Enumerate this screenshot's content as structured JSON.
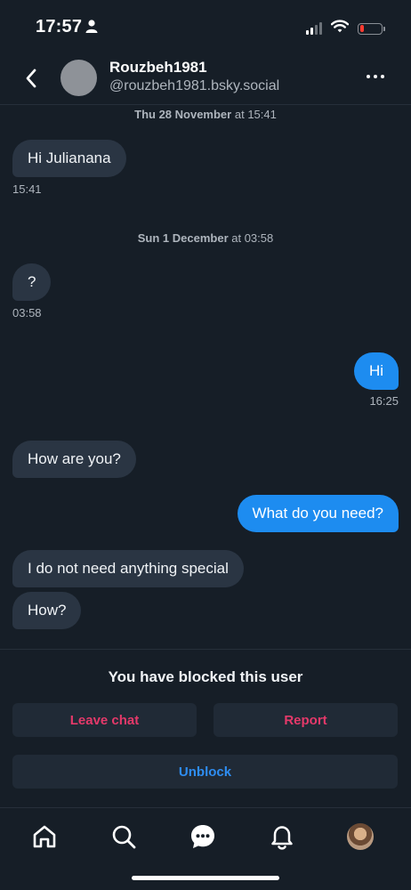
{
  "status_bar": {
    "time": "17:57",
    "battery_level": 0.18,
    "battery_color": "#ff3b30"
  },
  "header": {
    "name": "Rouzbeh1981",
    "handle": "@rouzbeh1981.bsky.social",
    "back_icon": "chevron-left-icon",
    "more_icon": "ellipsis-icon"
  },
  "conversation": {
    "date_1": {
      "day": "Thu 28 November",
      "time": "at 15:41"
    },
    "date_2": {
      "day": "Sun 1 December",
      "time": "at 03:58"
    },
    "messages": [
      {
        "text": "Hi Julianana",
        "direction": "incoming",
        "time": "15:41"
      },
      {
        "text": "?",
        "direction": "incoming",
        "time": "03:58"
      },
      {
        "text": "Hi",
        "direction": "outgoing",
        "time": "16:25"
      },
      {
        "text": "How are you?",
        "direction": "incoming"
      },
      {
        "text": "What do you need?",
        "direction": "outgoing"
      },
      {
        "text": "I do not need anything special",
        "direction": "incoming"
      },
      {
        "text": "How?",
        "direction": "incoming"
      }
    ]
  },
  "blocked": {
    "message": "You have blocked this user",
    "leave_label": "Leave chat",
    "report_label": "Report",
    "unblock_label": "Unblock"
  },
  "nav": {
    "items": [
      "home-icon",
      "search-icon",
      "chat-icon",
      "bell-icon",
      "profile-avatar"
    ]
  },
  "colors": {
    "background": "#161e27",
    "incoming_bubble": "#2a3543",
    "outgoing_bubble": "#1d8cf0",
    "danger": "#e5396a",
    "accent": "#2e8df2"
  }
}
